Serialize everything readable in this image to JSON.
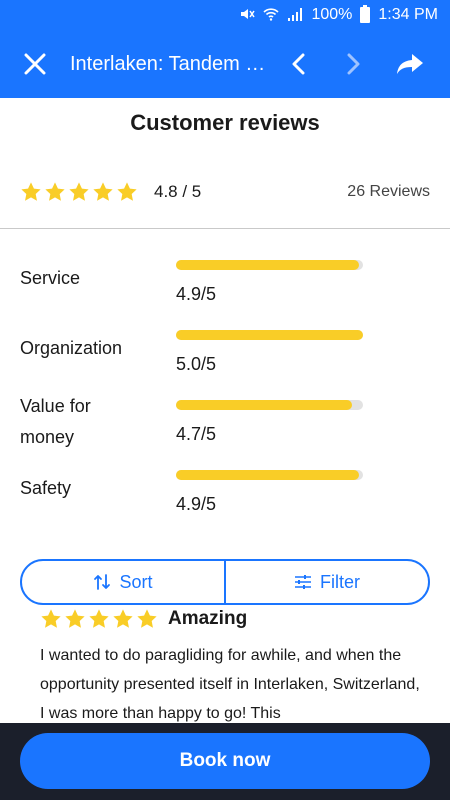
{
  "status_bar": {
    "battery": "100%",
    "time": "1:34 PM"
  },
  "app_bar": {
    "title": "Interlaken: Tandem P..."
  },
  "reviews": {
    "heading": "Customer reviews",
    "overall_rating": "4.8 / 5",
    "stars": 5,
    "count": "26 Reviews"
  },
  "criteria": [
    {
      "label": "Service",
      "value": "4.9/5",
      "fill": 0.98
    },
    {
      "label": "Organization",
      "value": "5.0/5",
      "fill": 1.0
    },
    {
      "label": "Value for money",
      "value": "4.7/5",
      "fill": 0.94
    },
    {
      "label": "Safety",
      "value": "4.9/5",
      "fill": 0.98
    }
  ],
  "actions": {
    "sort_label": "Sort",
    "filter_label": "Filter"
  },
  "review": {
    "title": "Amazing",
    "stars": 5,
    "text": "I wanted to do paragliding for awhile, and when the opportunity presented itself in Interlaken, Switzerland, I was more than happy to go! This"
  },
  "footer": {
    "book_label": "Book now"
  },
  "colors": {
    "accent": "#1a75ff",
    "star": "#f9cd27",
    "footer_bg": "#1b1f2b"
  }
}
